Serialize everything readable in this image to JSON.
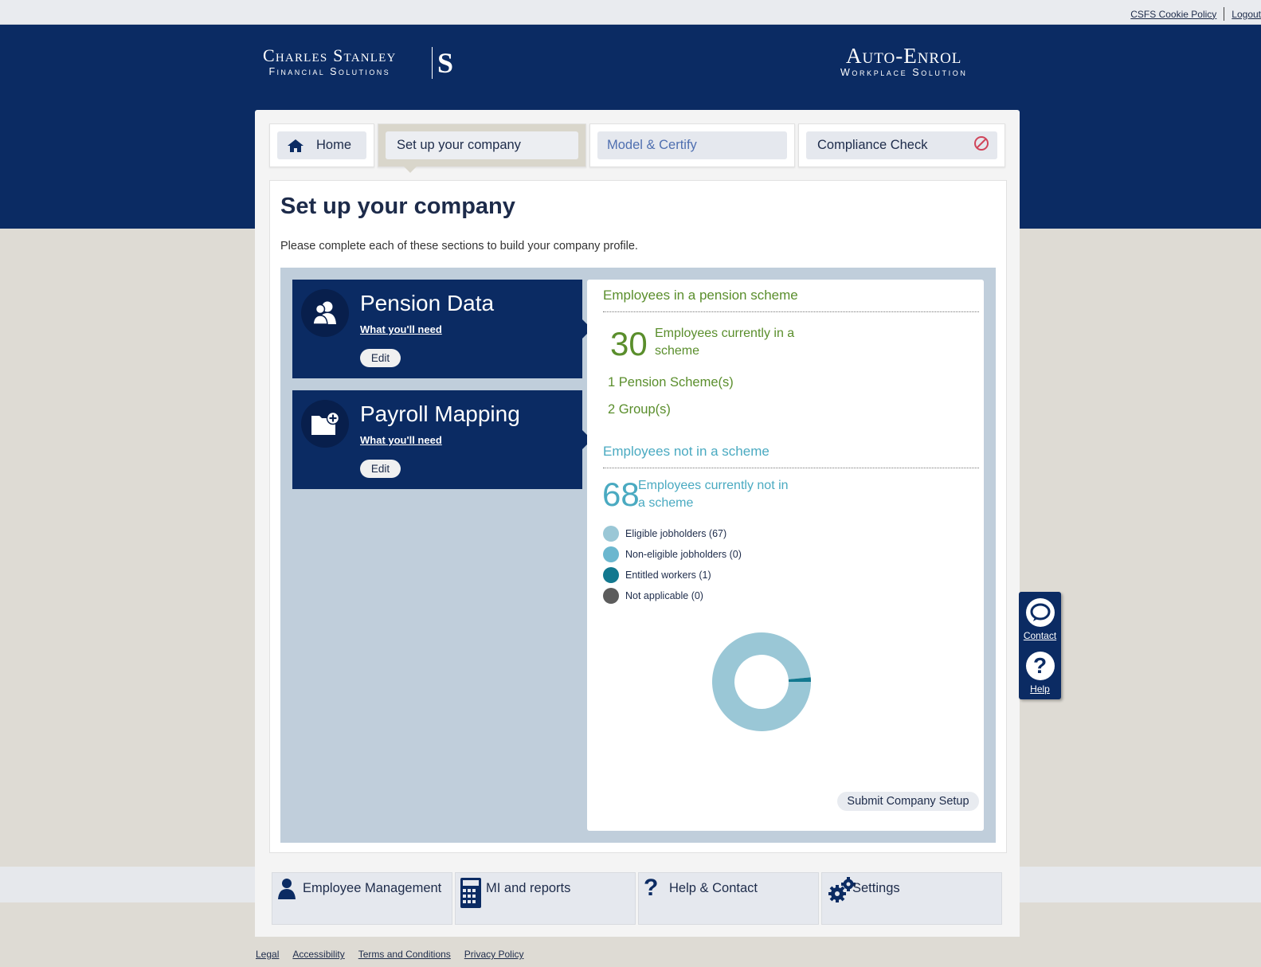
{
  "top_links": {
    "cookie_policy": "CSFS Cookie Policy",
    "logout": "Logout"
  },
  "brand": {
    "left_line1": "Charles Stanley",
    "left_line2": "Financial Solutions",
    "left_mark": "S",
    "right_line1": "Auto-Enrol",
    "right_line2": "Workplace Solution"
  },
  "tabs": [
    {
      "label": "Home",
      "icon": "home-icon"
    },
    {
      "label": "Set up your company"
    },
    {
      "label": "Model & Certify"
    },
    {
      "label": "Compliance Check",
      "icon": "no-entry-icon"
    }
  ],
  "page": {
    "title": "Set up your company",
    "intro": "Please complete each of these sections to build your company profile."
  },
  "cards": [
    {
      "title": "Pension Data",
      "link": "What you'll need",
      "edit": "Edit",
      "icon": "people-icon"
    },
    {
      "title": "Payroll Mapping",
      "link": "What you'll need",
      "edit": "Edit",
      "icon": "folder-add-icon"
    }
  ],
  "summary": {
    "in_scheme_heading": "Employees in a pension scheme",
    "in_scheme_count": "30",
    "in_scheme_desc": "Employees currently in a scheme",
    "pension_schemes": "1 Pension Scheme(s)",
    "groups": "2 Group(s)",
    "not_in_scheme_heading": "Employees not in a scheme",
    "not_in_scheme_count": "68",
    "not_in_scheme_desc": "Employees currently not in a scheme",
    "legend": [
      {
        "label": "Eligible jobholders (67)",
        "color": "#9ac7d6"
      },
      {
        "label": "Non-eligible jobholders (0)",
        "color": "#6bb7cf"
      },
      {
        "label": "Entitled workers (1)",
        "color": "#12788f"
      },
      {
        "label": "Not applicable (0)",
        "color": "#5c5c5c"
      }
    ],
    "submit": "Submit Company Setup"
  },
  "chart_data": {
    "type": "pie",
    "categories": [
      "Eligible jobholders",
      "Non-eligible jobholders",
      "Entitled workers",
      "Not applicable"
    ],
    "values": [
      67,
      0,
      1,
      0
    ],
    "colors": [
      "#9ac7d6",
      "#6bb7cf",
      "#12788f",
      "#5c5c5c"
    ]
  },
  "side_widget": {
    "contact": "Contact",
    "help": "Help"
  },
  "bottom_nav": [
    {
      "label": "Employee Management",
      "icon": "person-icon"
    },
    {
      "label": "MI and reports",
      "icon": "calculator-icon"
    },
    {
      "label": "Help & Contact",
      "icon": "question-icon"
    },
    {
      "label": "Settings",
      "icon": "gears-icon"
    }
  ],
  "footer": [
    "Legal",
    "Accessibility",
    "Terms and Conditions",
    "Privacy Policy"
  ]
}
